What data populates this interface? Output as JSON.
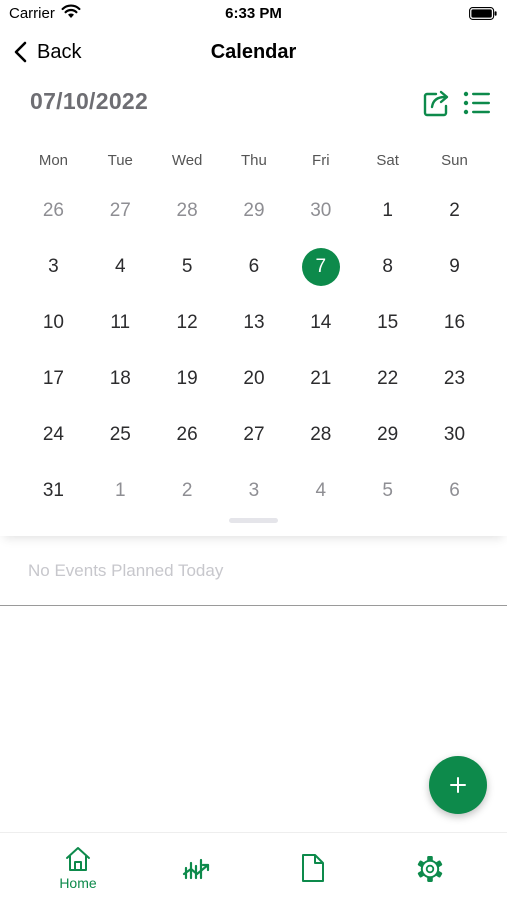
{
  "status": {
    "carrier": "Carrier",
    "time": "6:33 PM"
  },
  "nav": {
    "back_label": "Back",
    "title": "Calendar"
  },
  "calendar": {
    "selected_date": "07/10/2022",
    "weekdays": [
      "Mon",
      "Tue",
      "Wed",
      "Thu",
      "Fri",
      "Sat",
      "Sun"
    ],
    "days": [
      {
        "d": "26",
        "m": "other"
      },
      {
        "d": "27",
        "m": "other"
      },
      {
        "d": "28",
        "m": "other"
      },
      {
        "d": "29",
        "m": "other"
      },
      {
        "d": "30",
        "m": "other"
      },
      {
        "d": "1",
        "m": "cur"
      },
      {
        "d": "2",
        "m": "cur"
      },
      {
        "d": "3",
        "m": "cur"
      },
      {
        "d": "4",
        "m": "cur"
      },
      {
        "d": "5",
        "m": "cur"
      },
      {
        "d": "6",
        "m": "cur"
      },
      {
        "d": "7",
        "m": "sel"
      },
      {
        "d": "8",
        "m": "cur"
      },
      {
        "d": "9",
        "m": "cur"
      },
      {
        "d": "10",
        "m": "cur"
      },
      {
        "d": "11",
        "m": "cur"
      },
      {
        "d": "12",
        "m": "cur"
      },
      {
        "d": "13",
        "m": "cur"
      },
      {
        "d": "14",
        "m": "cur"
      },
      {
        "d": "15",
        "m": "cur"
      },
      {
        "d": "16",
        "m": "cur"
      },
      {
        "d": "17",
        "m": "cur"
      },
      {
        "d": "18",
        "m": "cur"
      },
      {
        "d": "19",
        "m": "cur"
      },
      {
        "d": "20",
        "m": "cur"
      },
      {
        "d": "21",
        "m": "cur"
      },
      {
        "d": "22",
        "m": "cur"
      },
      {
        "d": "23",
        "m": "cur"
      },
      {
        "d": "24",
        "m": "cur"
      },
      {
        "d": "25",
        "m": "cur"
      },
      {
        "d": "26",
        "m": "cur"
      },
      {
        "d": "27",
        "m": "cur"
      },
      {
        "d": "28",
        "m": "cur"
      },
      {
        "d": "29",
        "m": "cur"
      },
      {
        "d": "30",
        "m": "cur"
      },
      {
        "d": "31",
        "m": "cur"
      },
      {
        "d": "1",
        "m": "other"
      },
      {
        "d": "2",
        "m": "other"
      },
      {
        "d": "3",
        "m": "other"
      },
      {
        "d": "4",
        "m": "other"
      },
      {
        "d": "5",
        "m": "other"
      },
      {
        "d": "6",
        "m": "other"
      }
    ]
  },
  "events": {
    "empty_message": "No Events Planned Today"
  },
  "tabbar": {
    "tabs": [
      {
        "icon": "home-icon",
        "label": "Home"
      },
      {
        "icon": "chart-icon",
        "label": ""
      },
      {
        "icon": "document-icon",
        "label": ""
      },
      {
        "icon": "gear-icon",
        "label": ""
      }
    ]
  },
  "colors": {
    "accent": "#0d8a4b",
    "muted_text": "#8e8e93",
    "header_text": "#6e6e73"
  }
}
